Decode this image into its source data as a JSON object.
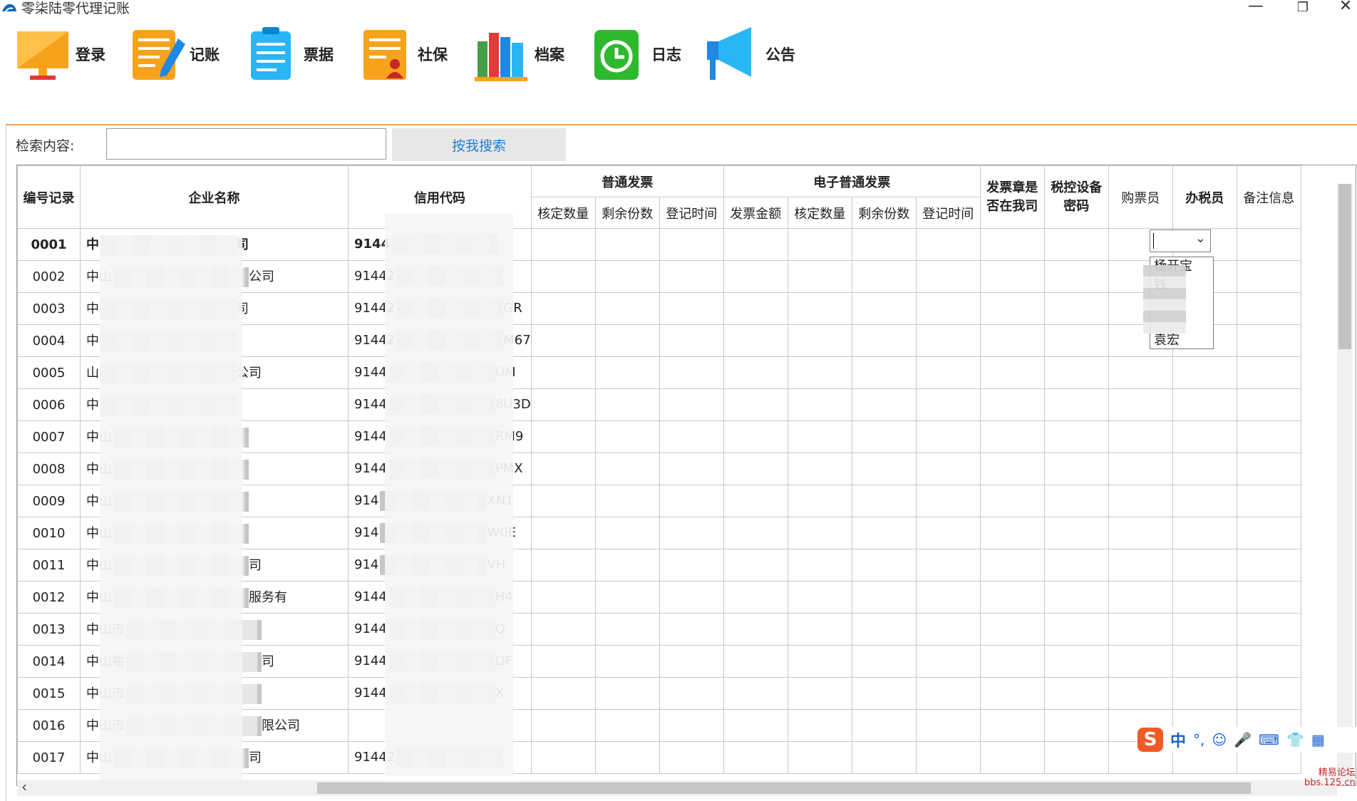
{
  "window": {
    "title": "零柒陆零代理记账",
    "controls": {
      "minimize": "—",
      "restore": "❐",
      "close": "✕"
    }
  },
  "toolbar": {
    "items": [
      {
        "label": "登录",
        "icon": "monitor-icon"
      },
      {
        "label": "记账",
        "icon": "notepad-pen-icon"
      },
      {
        "label": "票据",
        "icon": "clipboard-icon"
      },
      {
        "label": "社保",
        "icon": "user-document-icon"
      },
      {
        "label": "档案",
        "icon": "books-icon"
      },
      {
        "label": "日志",
        "icon": "clock-icon"
      },
      {
        "label": "公告",
        "icon": "megaphone-icon"
      }
    ]
  },
  "search": {
    "label": "检索内容:",
    "value": "",
    "button_label": "按我搜索"
  },
  "table": {
    "headers": {
      "id": "编号记录",
      "company": "企业名称",
      "credit_code": "信用代码",
      "normal_invoice": "普通发票",
      "e_invoice": "电子普通发票",
      "seal": "发票章是否在我司",
      "tax_device": "税控设备密码",
      "buyer": "购票员",
      "tax_officer": "办税员",
      "remarks": "备注信息"
    },
    "sub_headers": {
      "normal": [
        "核定数量",
        "剩余份数",
        "登记时间"
      ],
      "electronic": [
        "发票金额",
        "核定数量",
        "剩余份数",
        "登记时间"
      ]
    },
    "rows": [
      {
        "id": "0001",
        "company": "中",
        "company_tail": "司",
        "code": "9144",
        "code_tail": ""
      },
      {
        "id": "0002",
        "company": "中山",
        "company_tail": "公司",
        "code": "91442",
        "code_tail": ""
      },
      {
        "id": "0003",
        "company": "中",
        "company_tail": "司",
        "code": "91442",
        "code_tail": "GR"
      },
      {
        "id": "0004",
        "company": "中",
        "company_tail": "",
        "code": "91442",
        "code_tail": "M67"
      },
      {
        "id": "0005",
        "company": "山",
        "company_tail": "公司",
        "code": "9144",
        "code_tail": "UM"
      },
      {
        "id": "0006",
        "company": "中",
        "company_tail": "",
        "code": "9144",
        "code_tail": "8U3D"
      },
      {
        "id": "0007",
        "company": "中山",
        "company_tail": "",
        "code": "9144",
        "code_tail": "RM9"
      },
      {
        "id": "0008",
        "company": "中山",
        "company_tail": "",
        "code": "9144",
        "code_tail": "PMX"
      },
      {
        "id": "0009",
        "company": "中山",
        "company_tail": "",
        "code": "914",
        "code_tail": "XN1"
      },
      {
        "id": "0010",
        "company": "中山",
        "company_tail": "",
        "code": "914",
        "code_tail": "W0E"
      },
      {
        "id": "0011",
        "company": "中山",
        "company_tail": "司",
        "code": "914",
        "code_tail": "VH"
      },
      {
        "id": "0012",
        "company": "中山",
        "company_tail": "服务有",
        "code": "9144",
        "code_tail": "H4"
      },
      {
        "id": "0013",
        "company": "中山市",
        "company_tail": "",
        "code": "9144",
        "code_tail": "Q"
      },
      {
        "id": "0014",
        "company": "中山裕",
        "company_tail": "司",
        "code": "9144",
        "code_tail": "DF"
      },
      {
        "id": "0015",
        "company": "中山市",
        "company_tail": "",
        "code": "9144",
        "code_tail": "X"
      },
      {
        "id": "0016",
        "company": "中山市",
        "company_tail": "限公司",
        "code": "",
        "code_tail": ""
      },
      {
        "id": "0017",
        "company": "中山",
        "company_tail": "司",
        "code": "91442",
        "code_tail": ""
      }
    ]
  },
  "officer_combo": {
    "value": "",
    "options": [
      "杨开宝",
      "钱",
      "",
      "",
      "袁宏"
    ]
  },
  "ime_bar": {
    "logo": "S",
    "mode": "中",
    "punct": "°,",
    "items": [
      "☺",
      "🎤",
      "⌨",
      "👕",
      "▦"
    ]
  },
  "watermark": {
    "line1": "精易论坛",
    "line2": "bbs.125.cn"
  }
}
